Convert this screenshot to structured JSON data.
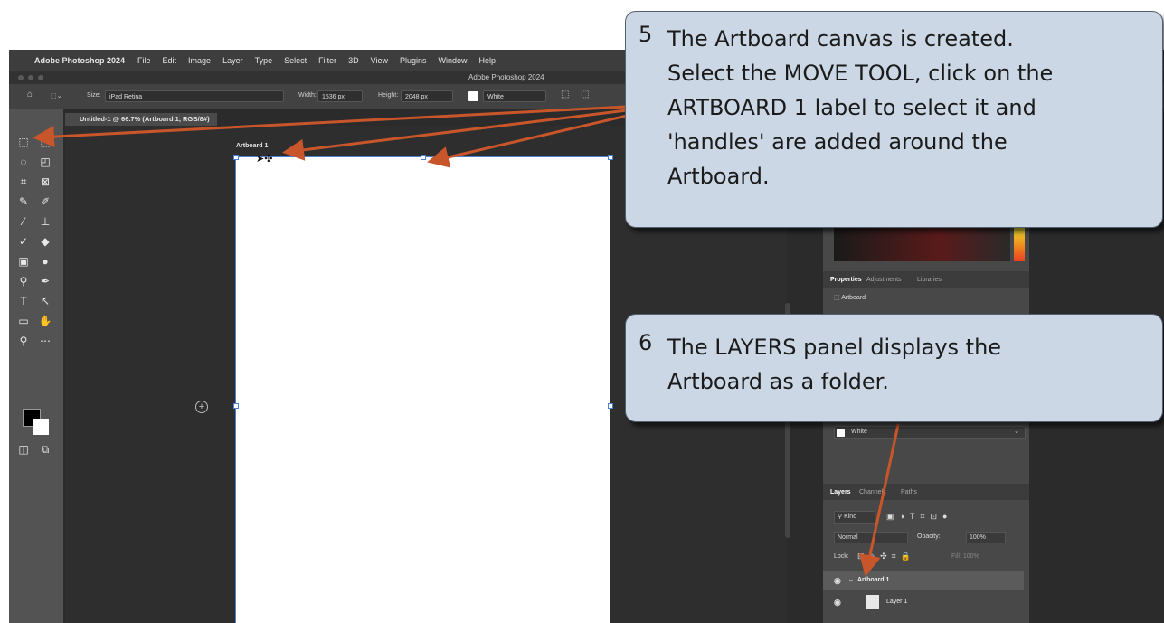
{
  "menubar": {
    "apple_icon": "apple-icon",
    "app_name": "Adobe Photoshop 2024",
    "items": [
      "File",
      "Edit",
      "Image",
      "Layer",
      "Type",
      "Select",
      "Filter",
      "3D",
      "View",
      "Plugins",
      "Window",
      "Help"
    ]
  },
  "titlebar": {
    "title": "Adobe Photoshop 2024"
  },
  "options": {
    "size_label": "Size:",
    "size_value": "iPad Retina",
    "width_label": "Width:",
    "width_value": "1536 px",
    "height_label": "Height:",
    "height_value": "2048 px",
    "color_value": "White"
  },
  "document": {
    "tab_title": "Untitled-1 @ 66.7% (Artboard 1, RGB/8#)"
  },
  "canvas": {
    "artboard_label": "Artboard 1"
  },
  "properties": {
    "tabs": [
      "Properties",
      "Adjustments",
      "Libraries"
    ],
    "type_label": "Artboard",
    "background_value": "White"
  },
  "layers": {
    "tabs": [
      "Layers",
      "Channels",
      "Paths"
    ],
    "filter_kind": "Kind",
    "blend_mode": "Normal",
    "opacity_label": "Opacity:",
    "opacity_value": "100%",
    "lock_label": "Lock:",
    "fill_label": "Fill: 100%",
    "rows": [
      {
        "name": "Artboard 1"
      },
      {
        "name": "Layer 1"
      }
    ]
  },
  "callouts": [
    {
      "number": "5",
      "lines": [
        "The Artboard canvas is created.",
        "Select the MOVE TOOL, click on the",
        "ARTBOARD 1 label to select it and",
        "'handles' are added around the",
        "Artboard."
      ]
    },
    {
      "number": "6",
      "lines": [
        "The LAYERS panel displays the",
        "Artboard as a folder."
      ]
    }
  ],
  "colors": {
    "callout_bg": "#cbd7e4",
    "arrow": "#c8562a",
    "artboard_border": "#4d7fd1"
  }
}
